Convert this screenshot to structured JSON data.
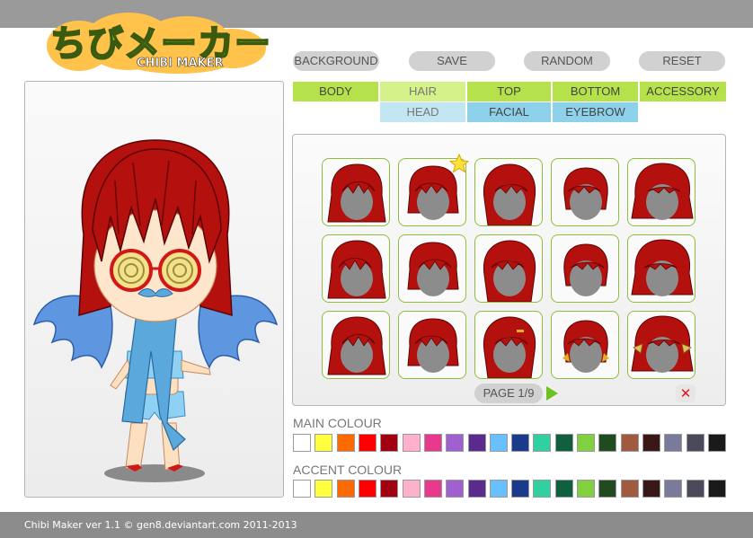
{
  "logo": {
    "japanese": "ちびメーカー",
    "english": "CHIBI MAKER"
  },
  "toolbar": {
    "background": "BACKGROUND",
    "save": "SAVE",
    "random": "RANDOM",
    "reset": "RESET"
  },
  "tabs": {
    "row1": [
      "BODY",
      "HAIR",
      "TOP",
      "BOTTOM",
      "ACCESSORY"
    ],
    "row2": [
      "HEAD",
      "FACIAL",
      "EYEBROW"
    ],
    "active": "HAIR"
  },
  "hair_grid": {
    "rows": 3,
    "cols": 5,
    "favorite_index": 1,
    "hair_color": "#b3100e"
  },
  "pagination": {
    "label": "PAGE 1/9"
  },
  "main_colour": {
    "label": "MAIN COLOUR",
    "swatches": [
      "#ffffff",
      "#ffff40",
      "#ff6a00",
      "#ff0000",
      "#a00010",
      "#ffb0cc",
      "#e83a8c",
      "#a060d0",
      "#5a2a8c",
      "#6ac0ff",
      "#1a3a8c",
      "#30d0a0",
      "#106040",
      "#80d040",
      "#204a20",
      "#a05a40",
      "#3a1818",
      "#7a7a9a",
      "#4a4a5a",
      "#1a1a1a"
    ]
  },
  "accent_colour": {
    "label": "ACCENT COLOUR",
    "swatches": [
      "#ffffff",
      "#ffff40",
      "#ff6a00",
      "#ff0000",
      "#a00010",
      "#ffb0cc",
      "#e83a8c",
      "#a060d0",
      "#5a2a8c",
      "#6ac0ff",
      "#1a3a8c",
      "#30d0a0",
      "#106040",
      "#80d040",
      "#204a20",
      "#a05a40",
      "#3a1818",
      "#7a7a9a",
      "#4a4a5a",
      "#1a1a1a"
    ]
  },
  "footer": {
    "text": "Chibi Maker ver 1.1 © gen8.deviantart.com 2011-2013"
  },
  "colors": {
    "tab_green": "#b5e24a",
    "tab_blue": "#8ed1ea",
    "hair_red": "#b3100e"
  }
}
